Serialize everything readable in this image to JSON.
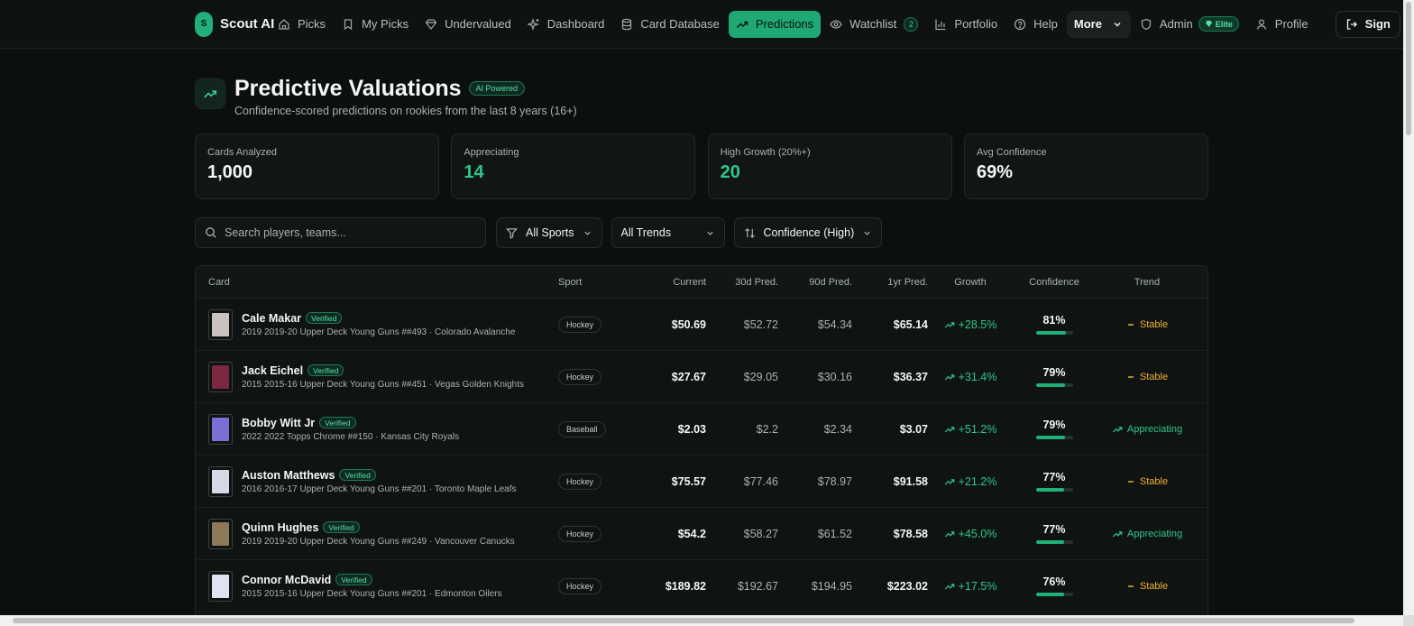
{
  "brand": {
    "logo_letter": "S",
    "name": "Scout AI"
  },
  "nav": {
    "picks": "Picks",
    "my_picks": "My Picks",
    "undervalued": "Undervalued",
    "dashboard": "Dashboard",
    "card_database": "Card Database",
    "predictions": "Predictions",
    "watchlist": "Watchlist",
    "watchlist_count": "2",
    "portfolio": "Portfolio",
    "help": "Help",
    "more": "More",
    "admin": "Admin",
    "elite": "Elite",
    "profile": "Profile",
    "sign": "Sign"
  },
  "header": {
    "title": "Predictive Valuations",
    "badge": "AI Powered",
    "subtitle": "Confidence-scored predictions on rookies from the last 8 years (16+)"
  },
  "stats": [
    {
      "label": "Cards Analyzed",
      "value": "1,000",
      "accent": false
    },
    {
      "label": "Appreciating",
      "value": "14",
      "accent": true
    },
    {
      "label": "High Growth (20%+)",
      "value": "20",
      "accent": true
    },
    {
      "label": "Avg Confidence",
      "value": "69%",
      "accent": false
    }
  ],
  "filters": {
    "search_placeholder": "Search players, teams...",
    "sport": "All Sports",
    "trend": "All Trends",
    "sort": "Confidence (High)"
  },
  "table": {
    "headers": {
      "card": "Card",
      "sport": "Sport",
      "current": "Current",
      "p30": "30d Pred.",
      "p90": "90d Pred.",
      "p1y": "1yr Pred.",
      "growth": "Growth",
      "confidence": "Confidence",
      "trend": "Trend"
    },
    "rows": [
      {
        "name": "Cale Makar",
        "verified": "Verified",
        "desc": "2019 2019-20 Upper Deck Young Guns ##493 · Colorado Avalanche",
        "sport": "Hockey",
        "current": "$50.69",
        "p30": "$52.72",
        "p90": "$54.34",
        "p1y": "$65.14",
        "growth": "+28.5%",
        "confidence": "81%",
        "confidence_value": 81,
        "trend": "Stable",
        "trend_type": "stable",
        "thumb_color": "#c9c2bf"
      },
      {
        "name": "Jack Eichel",
        "verified": "Verified",
        "desc": "2015 2015-16 Upper Deck Young Guns ##451 · Vegas Golden Knights",
        "sport": "Hockey",
        "current": "$27.67",
        "p30": "$29.05",
        "p90": "$30.16",
        "p1y": "$36.37",
        "growth": "+31.4%",
        "confidence": "79%",
        "confidence_value": 79,
        "trend": "Stable",
        "trend_type": "stable",
        "thumb_color": "#7a2940"
      },
      {
        "name": "Bobby Witt Jr",
        "verified": "Verified",
        "desc": "2022 2022 Topps Chrome ##150 · Kansas City Royals",
        "sport": "Baseball",
        "current": "$2.03",
        "p30": "$2.2",
        "p90": "$2.34",
        "p1y": "$3.07",
        "growth": "+51.2%",
        "confidence": "79%",
        "confidence_value": 79,
        "trend": "Appreciating",
        "trend_type": "up",
        "thumb_color": "#7b6fd6"
      },
      {
        "name": "Auston Matthews",
        "verified": "Verified",
        "desc": "2016 2016-17 Upper Deck Young Guns ##201 · Toronto Maple Leafs",
        "sport": "Hockey",
        "current": "$75.57",
        "p30": "$77.46",
        "p90": "$78.97",
        "p1y": "$91.58",
        "growth": "+21.2%",
        "confidence": "77%",
        "confidence_value": 77,
        "trend": "Stable",
        "trend_type": "stable",
        "thumb_color": "#d8d9e6"
      },
      {
        "name": "Quinn Hughes",
        "verified": "Verified",
        "desc": "2019 2019-20 Upper Deck Young Guns ##249 · Vancouver Canucks",
        "sport": "Hockey",
        "current": "$54.2",
        "p30": "$58.27",
        "p90": "$61.52",
        "p1y": "$78.58",
        "growth": "+45.0%",
        "confidence": "77%",
        "confidence_value": 77,
        "trend": "Appreciating",
        "trend_type": "up",
        "thumb_color": "#8c7a5a"
      },
      {
        "name": "Connor McDavid",
        "verified": "Verified",
        "desc": "2015 2015-16 Upper Deck Young Guns ##201 · Edmonton Oilers",
        "sport": "Hockey",
        "current": "$189.82",
        "p30": "$192.67",
        "p90": "$194.95",
        "p1y": "$223.02",
        "growth": "+17.5%",
        "confidence": "76%",
        "confidence_value": 76,
        "trend": "Stable",
        "trend_type": "stable",
        "thumb_color": "#dfe3ef"
      }
    ]
  },
  "colors": {
    "accent": "#22b07a",
    "stable": "#f2b134",
    "background": "#0b0f0e"
  }
}
